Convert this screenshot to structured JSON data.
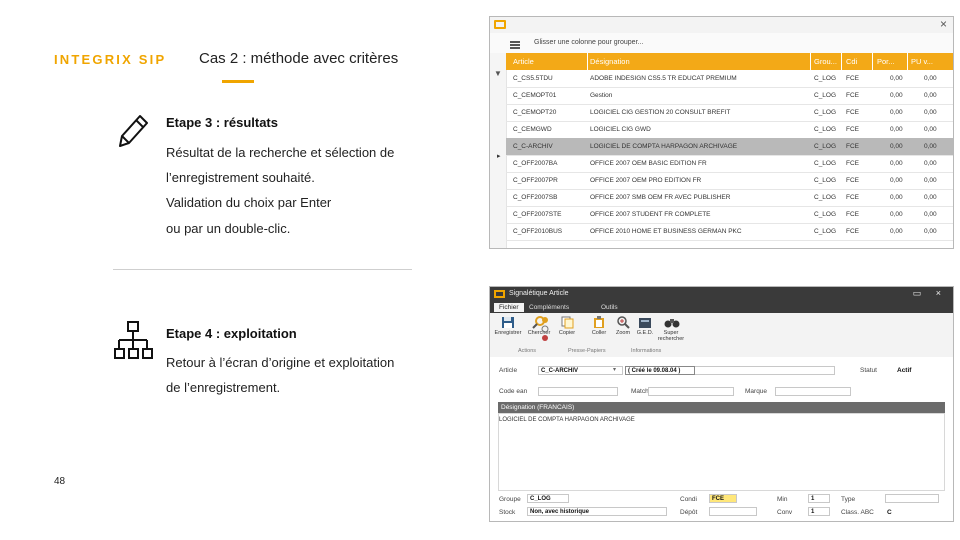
{
  "slide": {
    "brand": "INTEGRIX SIP",
    "title": "Cas 2 : méthode avec critères",
    "step3": {
      "title": "Etape 3 : résultats",
      "lines": [
        "Résultat de la recherche et sélection de",
        "l’enregistrement souhaité.",
        "Validation du choix par Enter",
        "ou par un double-clic."
      ]
    },
    "step4": {
      "title": "Etape 4 : exploitation",
      "lines": [
        "Retour à l’écran d’origine et exploitation",
        "de l’enregistrement."
      ]
    },
    "page_number": "48",
    "accent": "#f0a500"
  },
  "window1": {
    "close": "×",
    "group_hint": "Glisser une colonne pour grouper...",
    "columns": [
      "Article",
      "Désignation",
      "Grou...",
      "Cdi",
      "Por...",
      "PU v..."
    ],
    "rows": [
      [
        "C_CS5.5TDU",
        "ADOBE INDESIGN CS5.5 TR EDUCAT PREMIUM",
        "C_LOG",
        "FCE",
        "0,00",
        "0,00"
      ],
      [
        "C_CEMOPT01",
        "Gestion",
        "C_LOG",
        "FCE",
        "0,00",
        "0,00"
      ],
      [
        "C_CEMOPT20",
        "LOGICIEL CIG GESTION 20 CONSULT BREFIT",
        "C_LOG",
        "FCE",
        "0,00",
        "0,00"
      ],
      [
        "C_CEMGWD",
        "LOGICIEL CIG GWD",
        "C_LOG",
        "FCE",
        "0,00",
        "0,00"
      ],
      [
        "C_C-ARCHIV",
        "LOGICIEL DE COMPTA HARPAGON ARCHIVAGE",
        "C_LOG",
        "FCE",
        "0,00",
        "0,00"
      ],
      [
        "C_OFF2007BA",
        "OFFICE 2007 OEM BASIC EDITION FR",
        "C_LOG",
        "FCE",
        "0,00",
        "0,00"
      ],
      [
        "C_OFF2007PR",
        "OFFICE 2007 OEM PRO EDITION FR",
        "C_LOG",
        "FCE",
        "0,00",
        "0,00"
      ],
      [
        "C_OFF2007SB",
        "OFFICE 2007 SMB OEM FR AVEC PUBLISHER",
        "C_LOG",
        "FCE",
        "0,00",
        "0,00"
      ],
      [
        "C_OFF2007STE",
        "OFFICE 2007 STUDENT FR COMPLETE",
        "C_LOG",
        "FCE",
        "0,00",
        "0,00"
      ],
      [
        "C_OFF2010BUS",
        "OFFICE 2010 HOME ET BUSINESS GERMAN PKC",
        "C_LOG",
        "FCE",
        "0,00",
        "0,00"
      ]
    ],
    "selected_row": 4,
    "header_color": "#f3a917"
  },
  "window2": {
    "title": "Signalétique Article",
    "tabs": [
      "Fichier",
      "Compléments",
      "Outils"
    ],
    "ribbon_buttons": [
      "Enregistrer",
      "Chercher",
      "Copier",
      "Coller",
      "Zoom",
      "G.E.D.",
      "Super rechercher"
    ],
    "ribbon_groups": [
      "Actions",
      "Presse-Papiers",
      "Informations"
    ],
    "fields": {
      "article_label": "Article",
      "article_value": "C_C-ARCHIV",
      "created": "( Créé le 09.08.04 )",
      "statut_label": "Statut",
      "statut_value": "Actif",
      "code_ean_label": "Code ean",
      "matchcode_label": "Matchcode",
      "marque_label": "Marque",
      "designation_label": "Désignation (FRANCAIS)",
      "designation_value": "LOGICIEL DE COMPTA HARPAGON ARCHIVAGE",
      "groupe_label": "Groupe",
      "groupe_value": "C_LOG",
      "stock_label": "Stock",
      "stock_value": "Non, avec historique",
      "condi_label": "Condi",
      "condi_value": "FCE",
      "depot_label": "Dépôt",
      "min_label": "Min",
      "min_value": "1",
      "conv_label": "Conv",
      "conv_value": "1",
      "type_label": "Type",
      "class_label": "Class. ABC",
      "class_value": "C"
    }
  }
}
